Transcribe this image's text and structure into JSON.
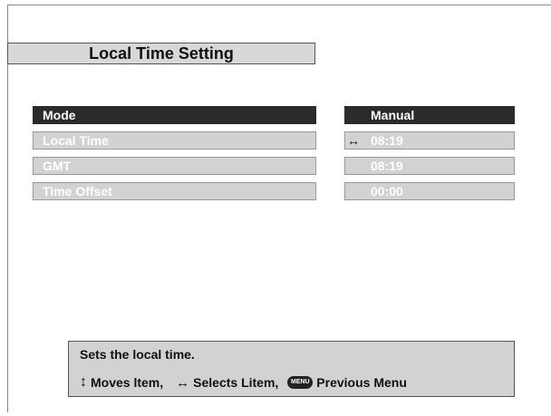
{
  "title": "Local Time Setting",
  "rows": [
    {
      "label": "Mode",
      "value": "Manual",
      "arrow": ""
    },
    {
      "label": "Local Time",
      "value": "08:19",
      "arrow": "↔"
    },
    {
      "label": "GMT",
      "value": "08:19",
      "arrow": ""
    },
    {
      "label": "Time Offset",
      "value": "00:00",
      "arrow": ""
    }
  ],
  "help": {
    "description": "Sets the local time.",
    "moves_icon": "↕",
    "moves_label": "Moves ltem,",
    "selects_icon": "↔",
    "selects_label": "Selects Litem,",
    "menu_icon": "MENU",
    "menu_label": "Previous Menu"
  },
  "colors": {
    "selected": "#2b2b2b",
    "unselected": "#d2d2d2"
  }
}
